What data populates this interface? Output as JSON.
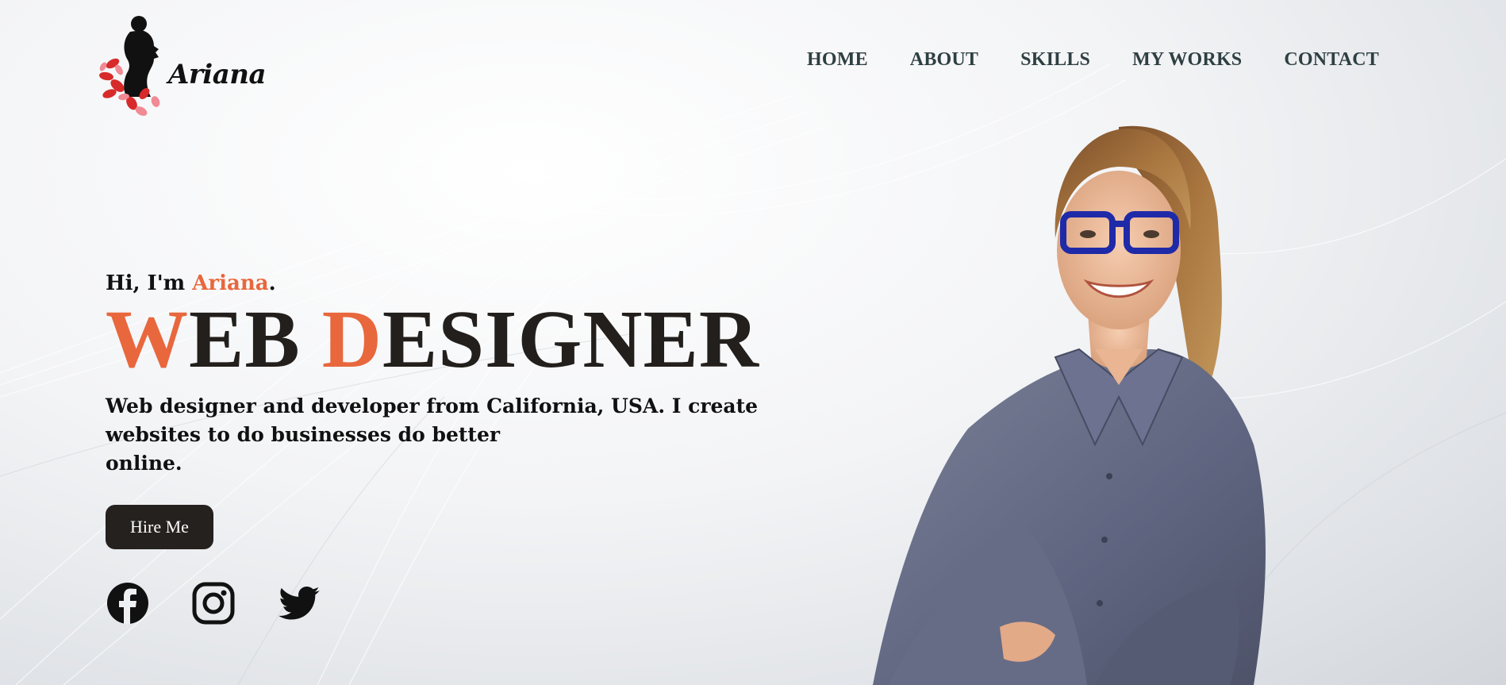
{
  "brand": {
    "name": "Ariana"
  },
  "nav": {
    "items": [
      {
        "label": "HOME"
      },
      {
        "label": "ABOUT"
      },
      {
        "label": "SKILLS"
      },
      {
        "label": "MY WORKS"
      },
      {
        "label": "CONTACT"
      }
    ]
  },
  "hero": {
    "greeting_prefix": "Hi, I'm ",
    "greeting_name": "Ariana",
    "greeting_suffix": ".",
    "headline": {
      "word1_initial": "W",
      "word1_rest": "EB ",
      "word2_initial": "D",
      "word2_rest": "ESIGNER"
    },
    "description_lines": [
      "Web designer and developer from California, USA. I create",
      "websites to do businesses do better",
      "online."
    ],
    "cta_label": "Hire Me"
  },
  "socials": {
    "icons": [
      "facebook-icon",
      "instagram-icon",
      "twitter-icon"
    ]
  },
  "colors": {
    "accent": "#e8673d",
    "dark": "#231f1c",
    "nav_text": "#2e3f42",
    "button_bg": "#25211f"
  }
}
